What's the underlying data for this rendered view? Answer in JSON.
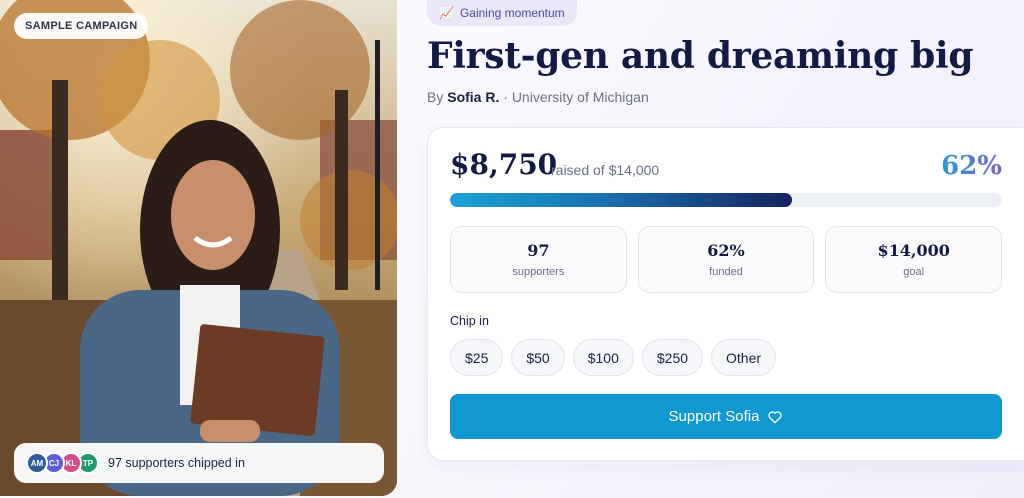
{
  "campaign": {
    "badge": "SAMPLE CAMPAIGN",
    "status_tag": "Gaining momentum",
    "status_icon": "chart-up-icon",
    "title": "First-gen and dreaming big",
    "byline_prefix": "By",
    "author": "Sofia R.",
    "byline_separator": "·",
    "school": "University of Michigan"
  },
  "funding": {
    "raised": "$8,750",
    "raised_of": "raised of $14,000",
    "percent_label": "62%",
    "progress_fraction": 0.62,
    "stats": [
      {
        "value": "97",
        "label": "supporters"
      },
      {
        "value": "62%",
        "label": "funded"
      },
      {
        "value": "$14,000",
        "label": "goal"
      }
    ]
  },
  "chip_in": {
    "label": "Chip in",
    "options": [
      "$25",
      "$50",
      "$100",
      "$250",
      "Other"
    ]
  },
  "cta": {
    "label": "Support Sofia",
    "icon": "heart-icon"
  },
  "supporters_strip": {
    "avatars": [
      {
        "initials": "AM",
        "color": "#2f5b9a"
      },
      {
        "initials": "CJ",
        "color": "#5b5fd6"
      },
      {
        "initials": "KL",
        "color": "#d64b8c"
      },
      {
        "initials": "TP",
        "color": "#1f9b6f"
      }
    ],
    "text": "97 supporters chipped in"
  },
  "colors": {
    "accent": "#1298d0",
    "title": "#141a46",
    "status_bg": "#ebe7fb"
  }
}
